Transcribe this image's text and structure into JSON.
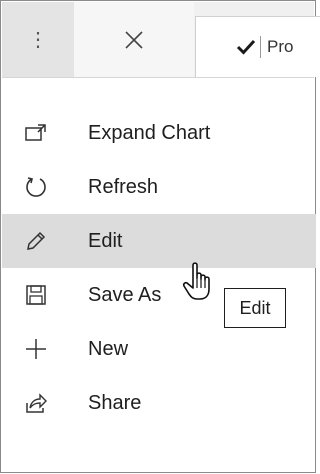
{
  "toolbar": {
    "more_icon": "⋮",
    "close_icon": "close-icon",
    "tab_label": "Pro"
  },
  "menu": {
    "items": [
      {
        "label": "Expand Chart",
        "icon": "expand-icon"
      },
      {
        "label": "Refresh",
        "icon": "refresh-icon"
      },
      {
        "label": "Edit",
        "icon": "pencil-icon"
      },
      {
        "label": "Save As",
        "icon": "save-icon"
      },
      {
        "label": "New",
        "icon": "plus-icon"
      },
      {
        "label": "Share",
        "icon": "share-icon"
      }
    ]
  },
  "tooltip": {
    "text": "Edit"
  },
  "colors": {
    "hover_bg": "#dcdcdc",
    "topbar_bg": "#f0f0f0",
    "more_bg": "#e4e4e4"
  }
}
